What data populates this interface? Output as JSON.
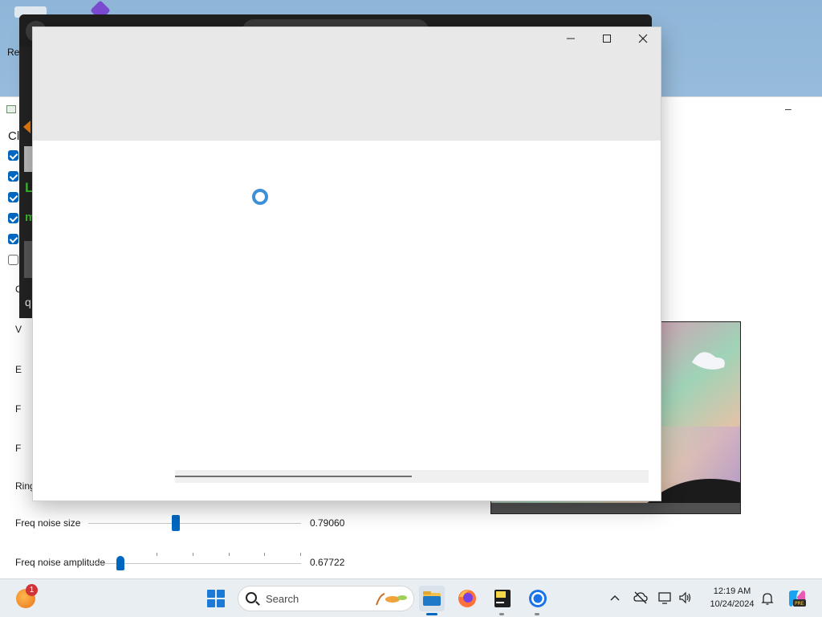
{
  "desktop": {
    "icon_label": "Re"
  },
  "background_editor": {
    "green_text_1": "L",
    "green_text_2": "m",
    "bottom_text": "q"
  },
  "app_window": {
    "heading": "Cl",
    "checkboxes": [
      {
        "checked": true
      },
      {
        "checked": true
      },
      {
        "checked": true
      },
      {
        "checked": true
      },
      {
        "checked": true
      },
      {
        "checked": false
      }
    ],
    "row_labels": [
      "C",
      "V",
      "E",
      "F",
      "F",
      "Ring"
    ],
    "sliders": [
      {
        "label": "Freq noise size",
        "value": "0.79060",
        "position": 0.41
      },
      {
        "label": "Freq noise amplitude",
        "value": "0.67722",
        "position": 0.0
      }
    ],
    "minimize_label": "–"
  },
  "dialog": {
    "progress": 0.5
  },
  "taskbar": {
    "notification_count": "1",
    "search_placeholder": "Search",
    "apps": [
      "file-explorer",
      "firefox",
      "terminal-app",
      "chrome"
    ],
    "time": "12:19 AM",
    "date": "10/24/2024"
  },
  "colors": {
    "accent": "#0067c0",
    "dialog_header": "#e8e8e8",
    "spinner": "#3d8fd6"
  }
}
